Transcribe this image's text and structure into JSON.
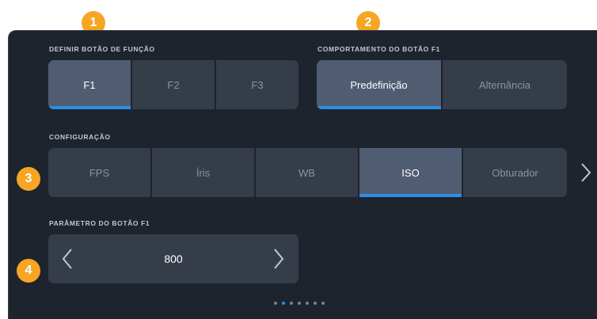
{
  "badges": [
    "1",
    "2",
    "3",
    "4"
  ],
  "sections": {
    "function_button": {
      "label": "DEFINIR BOTÃO DE FUNÇÃO",
      "options": [
        "F1",
        "F2",
        "F3"
      ],
      "selected": "F1"
    },
    "button_behavior": {
      "label": "COMPORTAMENTO DO BOTÃO F1",
      "options": [
        "Predefinição",
        "Alternância"
      ],
      "selected": "Predefinição"
    },
    "configuration": {
      "label": "CONFIGURAÇÃO",
      "options": [
        "FPS",
        "Íris",
        "WB",
        "ISO",
        "Obturador"
      ],
      "selected": "ISO"
    },
    "parameter": {
      "label": "PARÂMETRO DO BOTÃO F1",
      "value": "800"
    }
  },
  "pagination": {
    "total": 7,
    "current": 2
  },
  "colors": {
    "accent": "#2a8fe6",
    "badge": "#f6a623",
    "background": "#1e242d"
  }
}
